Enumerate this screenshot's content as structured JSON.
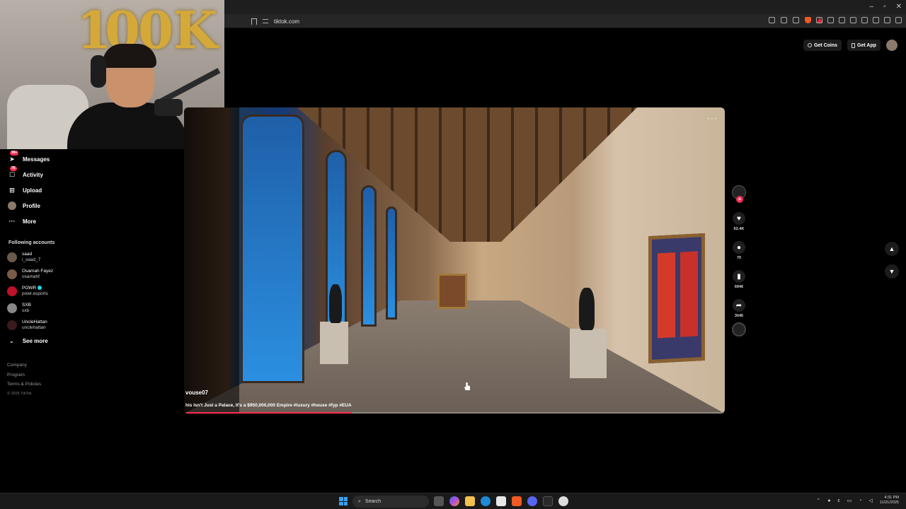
{
  "browser": {
    "url": "tiktok.com",
    "window_controls": [
      "–",
      "▫",
      "✕"
    ]
  },
  "webcam": {
    "balloon_text": [
      "1",
      "0",
      "0",
      "K"
    ]
  },
  "sidebar": {
    "items": [
      {
        "label": "Messages",
        "icon": "paper-plane-icon",
        "badge": "99+"
      },
      {
        "label": "Activity",
        "icon": "inbox-icon",
        "badge": "76"
      },
      {
        "label": "Upload",
        "icon": "plus-square-icon"
      },
      {
        "label": "Profile",
        "icon": "avatar-icon"
      },
      {
        "label": "More",
        "icon": "ellipsis-icon"
      }
    ],
    "following_title": "Following accounts",
    "accounts": [
      {
        "name": "saad",
        "handle": "i_saad_7"
      },
      {
        "name": "Osamah Fayez",
        "handle": "osamahf"
      },
      {
        "name": "POWR",
        "handle": "powr.esports",
        "verified": true
      },
      {
        "name": "SXB",
        "handle": "sxb"
      },
      {
        "name": "UncleHattan",
        "handle": "unclehattan"
      }
    ],
    "see_more": "See more",
    "footer": [
      "Company",
      "Program",
      "Terms & Policies"
    ],
    "copyright": "© 2025 TikTok"
  },
  "top_actions": {
    "get_coins": "Get Coins",
    "get_app": "Get App"
  },
  "video": {
    "author": "vouse07",
    "caption": "his Isn't Just a Palace, It's a $950,000,000 Empire #luxury #house #fyp #EUA",
    "progress": 0.31,
    "more": "···"
  },
  "actions": {
    "likes": "62.4K",
    "comments": "70",
    "saves": "6946",
    "shares": "3046"
  },
  "taskbar": {
    "search_placeholder": "Search",
    "time": "4:31 PM",
    "date": "11/21/2025"
  },
  "colors": {
    "accent": "#fe2c55",
    "background": "#000000"
  }
}
